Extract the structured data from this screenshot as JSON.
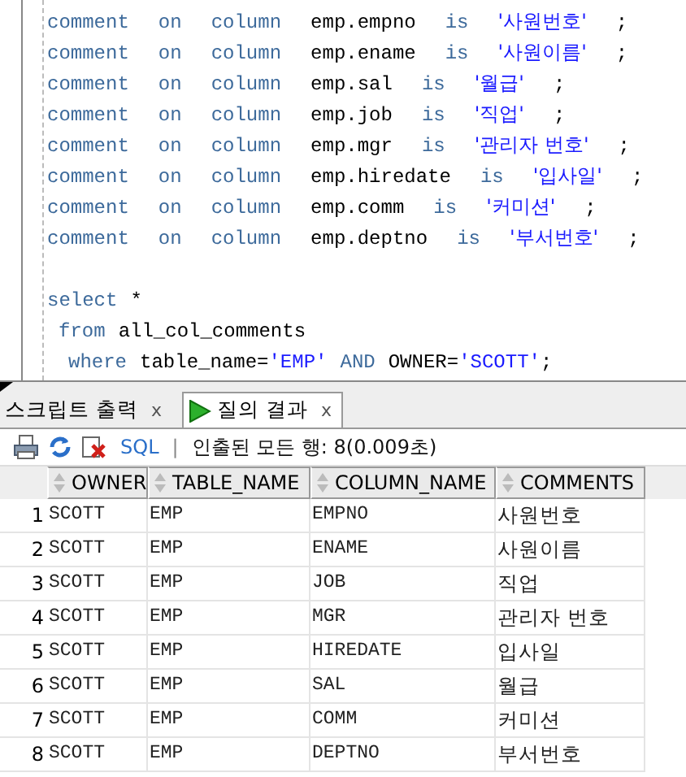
{
  "editor": {
    "lines": [
      {
        "kind": "statement",
        "words": [
          [
            {
              "text": "comment",
              "kind": "keyword"
            }
          ],
          [
            {
              "text": "on",
              "kind": "keyword"
            }
          ],
          [
            {
              "text": "column",
              "kind": "keyword"
            }
          ],
          [
            {
              "text": "emp.empno",
              "kind": "plain"
            }
          ],
          [
            {
              "text": "is",
              "kind": "keyword"
            }
          ],
          [
            {
              "text": "'사원번호'",
              "kind": "string"
            }
          ],
          [
            {
              "text": ";",
              "kind": "plain"
            }
          ]
        ]
      },
      {
        "kind": "statement",
        "words": [
          [
            {
              "text": "comment",
              "kind": "keyword"
            }
          ],
          [
            {
              "text": "on",
              "kind": "keyword"
            }
          ],
          [
            {
              "text": "column",
              "kind": "keyword"
            }
          ],
          [
            {
              "text": "emp.ename",
              "kind": "plain"
            }
          ],
          [
            {
              "text": "is",
              "kind": "keyword"
            }
          ],
          [
            {
              "text": "'사원이름'",
              "kind": "string"
            }
          ],
          [
            {
              "text": ";",
              "kind": "plain"
            }
          ]
        ]
      },
      {
        "kind": "statement",
        "words": [
          [
            {
              "text": "comment",
              "kind": "keyword"
            }
          ],
          [
            {
              "text": "on",
              "kind": "keyword"
            }
          ],
          [
            {
              "text": "column",
              "kind": "keyword"
            }
          ],
          [
            {
              "text": "emp.sal",
              "kind": "plain"
            }
          ],
          [
            {
              "text": "is",
              "kind": "keyword"
            }
          ],
          [
            {
              "text": "'월급'",
              "kind": "string"
            }
          ],
          [
            {
              "text": ";",
              "kind": "plain"
            }
          ]
        ]
      },
      {
        "kind": "statement",
        "words": [
          [
            {
              "text": "comment",
              "kind": "keyword"
            }
          ],
          [
            {
              "text": "on",
              "kind": "keyword"
            }
          ],
          [
            {
              "text": "column",
              "kind": "keyword"
            }
          ],
          [
            {
              "text": "emp.job",
              "kind": "plain"
            }
          ],
          [
            {
              "text": "is",
              "kind": "keyword"
            }
          ],
          [
            {
              "text": "'직업'",
              "kind": "string"
            }
          ],
          [
            {
              "text": ";",
              "kind": "plain"
            }
          ]
        ]
      },
      {
        "kind": "statement",
        "words": [
          [
            {
              "text": "comment",
              "kind": "keyword"
            }
          ],
          [
            {
              "text": "on",
              "kind": "keyword"
            }
          ],
          [
            {
              "text": "column",
              "kind": "keyword"
            }
          ],
          [
            {
              "text": "emp.mgr",
              "kind": "plain"
            }
          ],
          [
            {
              "text": "is",
              "kind": "keyword"
            }
          ],
          [
            {
              "text": "'관리자 번호'",
              "kind": "string"
            }
          ],
          [
            {
              "text": ";",
              "kind": "plain"
            }
          ]
        ]
      },
      {
        "kind": "statement",
        "words": [
          [
            {
              "text": "comment",
              "kind": "keyword"
            }
          ],
          [
            {
              "text": "on",
              "kind": "keyword"
            }
          ],
          [
            {
              "text": "column",
              "kind": "keyword"
            }
          ],
          [
            {
              "text": "emp.hiredate",
              "kind": "plain"
            }
          ],
          [
            {
              "text": "is",
              "kind": "keyword"
            }
          ],
          [
            {
              "text": "'입사일'",
              "kind": "string"
            }
          ],
          [
            {
              "text": ";",
              "kind": "plain"
            }
          ]
        ]
      },
      {
        "kind": "statement",
        "words": [
          [
            {
              "text": "comment",
              "kind": "keyword"
            }
          ],
          [
            {
              "text": "on",
              "kind": "keyword"
            }
          ],
          [
            {
              "text": "column",
              "kind": "keyword"
            }
          ],
          [
            {
              "text": "emp.comm",
              "kind": "plain"
            }
          ],
          [
            {
              "text": "is",
              "kind": "keyword"
            }
          ],
          [
            {
              "text": "'커미션'",
              "kind": "string"
            }
          ],
          [
            {
              "text": ";",
              "kind": "plain"
            }
          ]
        ]
      },
      {
        "kind": "statement",
        "words": [
          [
            {
              "text": "comment",
              "kind": "keyword"
            }
          ],
          [
            {
              "text": "on",
              "kind": "keyword"
            }
          ],
          [
            {
              "text": "column",
              "kind": "keyword"
            }
          ],
          [
            {
              "text": "emp.deptno",
              "kind": "plain"
            }
          ],
          [
            {
              "text": "is",
              "kind": "keyword"
            }
          ],
          [
            {
              "text": "'부서번호'",
              "kind": "string"
            }
          ],
          [
            {
              "text": ";",
              "kind": "plain"
            }
          ]
        ]
      },
      {
        "kind": "blank"
      },
      {
        "kind": "query",
        "words": [
          [
            {
              "text": "select",
              "kind": "keyword"
            }
          ],
          [
            {
              "text": "*",
              "kind": "plain"
            }
          ]
        ]
      },
      {
        "kind": "clause",
        "words": [
          [
            {
              "text": "from",
              "kind": "keyword"
            }
          ],
          [
            {
              "text": "all_col_comments",
              "kind": "plain"
            }
          ]
        ]
      },
      {
        "kind": "subclause",
        "words": [
          [
            {
              "text": "where",
              "kind": "keyword"
            }
          ],
          [
            {
              "text": "table_name=",
              "kind": "plain"
            },
            {
              "text": "'EMP'",
              "kind": "string"
            }
          ],
          [
            {
              "text": "AND",
              "kind": "keyword"
            }
          ],
          [
            {
              "text": "OWNER=",
              "kind": "plain"
            },
            {
              "text": "'SCOTT'",
              "kind": "string"
            },
            {
              "text": ";",
              "kind": "plain"
            }
          ]
        ]
      }
    ]
  },
  "tabs": [
    {
      "label": "스크립트 출력",
      "close": "x",
      "selected": false
    },
    {
      "label": "질의 결과",
      "close": "x",
      "selected": true
    }
  ],
  "toolbar": {
    "sql": "SQL",
    "separator": "|",
    "status": "인출된 모든 행: 8(0.009초)"
  },
  "table": {
    "columns": [
      "OWNER",
      "TABLE_NAME",
      "COLUMN_NAME",
      "COMMENTS"
    ],
    "rows": [
      {
        "num": "1",
        "cells": [
          "SCOTT",
          "EMP",
          "EMPNO",
          "사원번호"
        ]
      },
      {
        "num": "2",
        "cells": [
          "SCOTT",
          "EMP",
          "ENAME",
          "사원이름"
        ]
      },
      {
        "num": "3",
        "cells": [
          "SCOTT",
          "EMP",
          "JOB",
          "직업"
        ]
      },
      {
        "num": "4",
        "cells": [
          "SCOTT",
          "EMP",
          "MGR",
          "관리자 번호"
        ]
      },
      {
        "num": "5",
        "cells": [
          "SCOTT",
          "EMP",
          "HIREDATE",
          "입사일"
        ]
      },
      {
        "num": "6",
        "cells": [
          "SCOTT",
          "EMP",
          "SAL",
          "월급"
        ]
      },
      {
        "num": "7",
        "cells": [
          "SCOTT",
          "EMP",
          "COMM",
          "커미션"
        ]
      },
      {
        "num": "8",
        "cells": [
          "SCOTT",
          "EMP",
          "DEPTNO",
          "부서번호"
        ]
      }
    ]
  }
}
